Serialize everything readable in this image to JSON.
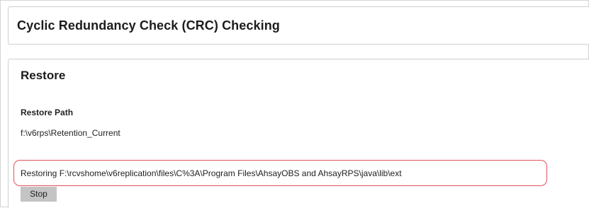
{
  "header": {
    "title": "Cyclic Redundancy Check (CRC) Checking"
  },
  "restore": {
    "section_title": "Restore",
    "path_label": "Restore Path",
    "path_value": "f:\\v6rps\\Retention_Current",
    "status_text": "Restoring F:\\rcvshome\\v6replication\\files\\C%3A\\Program Files\\AhsayOBS and AhsayRPS\\java\\lib\\ext",
    "stop_label": "Stop"
  },
  "colors": {
    "highlight_border": "#e0525a",
    "button_bg": "#c4c4c4"
  }
}
